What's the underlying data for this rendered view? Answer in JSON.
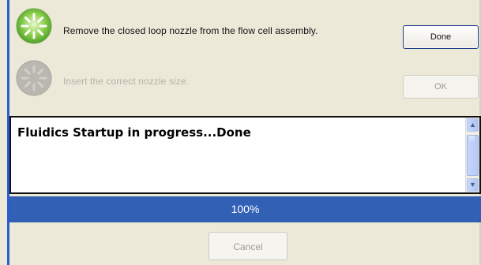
{
  "steps": [
    {
      "text": "Remove the closed loop nozzle from the flow cell assembly.",
      "button_label": "Done",
      "state": "active",
      "icon": "spinner-icon",
      "icon_color": "#7cc142"
    },
    {
      "text": "Insert the correct nozzle size.",
      "button_label": "OK",
      "state": "disabled",
      "icon": "spinner-icon",
      "icon_color": "#b7b5ae"
    }
  ],
  "log": {
    "text": "Fluidics Startup in progress...Done"
  },
  "progress": {
    "label": "100%",
    "value": 1.0,
    "color": "#3160b5"
  },
  "cancel_label": "Cancel"
}
